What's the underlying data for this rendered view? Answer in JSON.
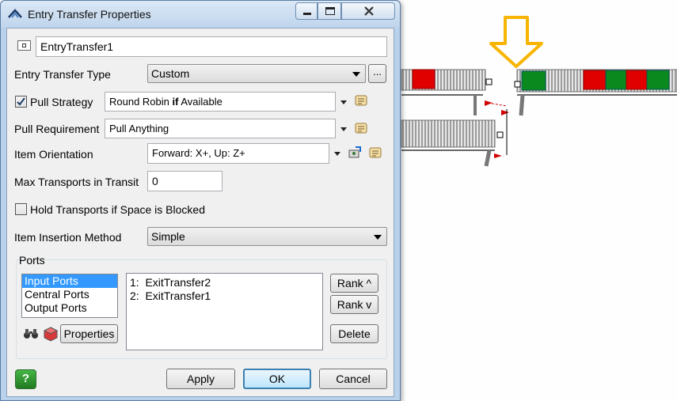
{
  "window": {
    "title": "Entry Transfer Properties",
    "controls": {
      "minimize": "minimize-icon",
      "maximize": "maximize-icon",
      "close": "close-icon"
    }
  },
  "object": {
    "name": "EntryTransfer1"
  },
  "entry_transfer_type": {
    "label": "Entry Transfer Type",
    "value": "Custom",
    "more_button": "..."
  },
  "pull_strategy": {
    "label": "Pull Strategy",
    "checked": true,
    "value_before": "Round Robin ",
    "value_bold": "if",
    "value_after": " Available"
  },
  "pull_requirement": {
    "label": "Pull Requirement",
    "value": "Pull Anything"
  },
  "item_orientation": {
    "label": "Item Orientation",
    "value": "Forward: X+, Up: Z+"
  },
  "max_transports": {
    "label": "Max Transports in Transit",
    "value": "0"
  },
  "hold_transports": {
    "label": "Hold Transports if Space is Blocked",
    "checked": false
  },
  "insertion_method": {
    "label": "Item Insertion Method",
    "value": "Simple"
  },
  "ports": {
    "group_label": "Ports",
    "types": [
      "Input Ports",
      "Central Ports",
      "Output Ports"
    ],
    "selected_type": "Input Ports",
    "connections": [
      "1:  ExitTransfer2",
      "2:  ExitTransfer1"
    ],
    "properties_button": "Properties",
    "rank_up_button": "Rank ^",
    "rank_down_button": "Rank v",
    "delete_button": "Delete"
  },
  "footer": {
    "apply_button": "Apply",
    "ok_button": "OK",
    "cancel_button": "Cancel"
  },
  "colors": {
    "arrow": "#f7b500",
    "red_item": "#e00000",
    "green_item": "#0a8a1e",
    "selection": "#3399ff",
    "help_button": "#2e9b2e"
  }
}
